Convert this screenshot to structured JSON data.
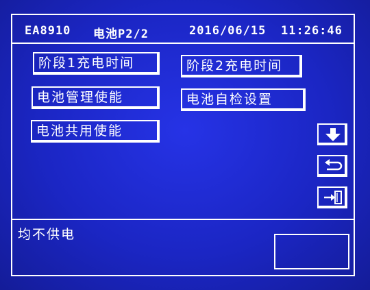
{
  "header": {
    "model": "EA8910",
    "page_title": "电池P2/2",
    "date": "2016/06/15",
    "time": "11:26:46"
  },
  "buttons": {
    "stage1_charge_time": "阶段1充电时间",
    "stage2_charge_time": "阶段2充电时间",
    "battery_management_enable": "电池管理使能",
    "battery_selftest_settings": "电池自检设置",
    "battery_shared_enable": "电池共用使能"
  },
  "icons": {
    "page_down": "down-arrow-icon",
    "back": "return-icon",
    "exit": "exit-icon"
  },
  "status": {
    "message": "均不供电"
  },
  "colors": {
    "background": "#1a22b8",
    "foreground": "#ffffff"
  }
}
